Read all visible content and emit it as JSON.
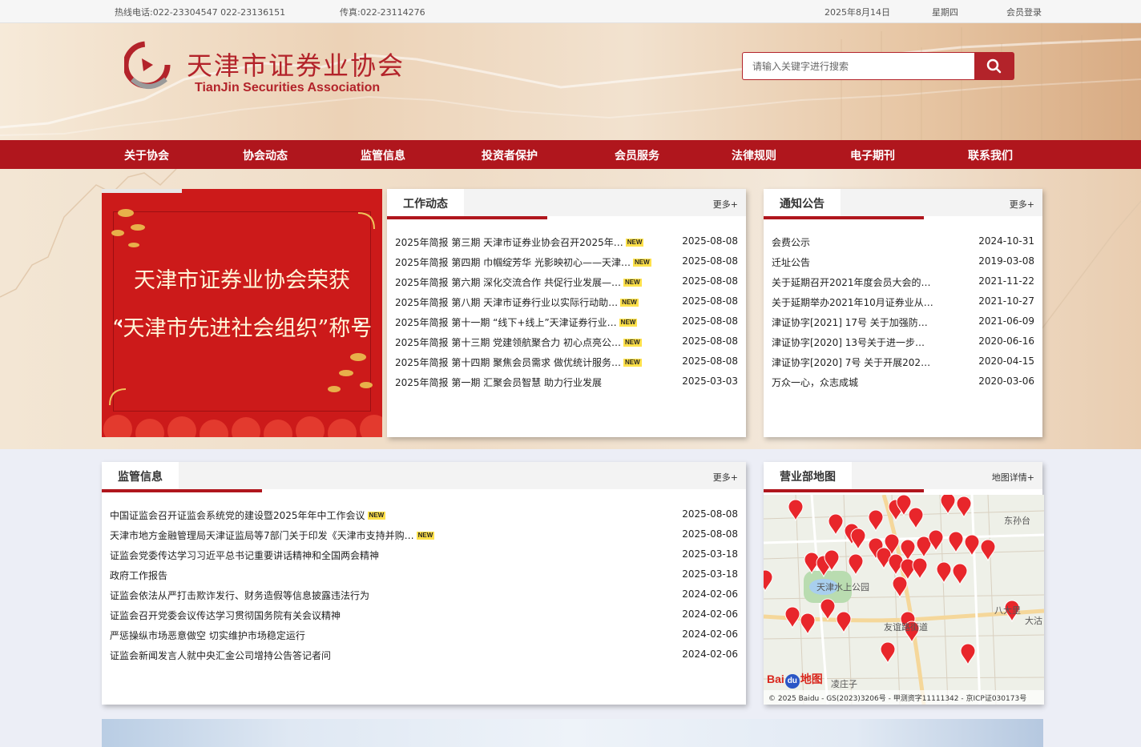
{
  "topbar": {
    "hotline": "热线电话:022-23304547  022-23136151",
    "fax": "传真:022-23114276",
    "date": "2025年8月14日",
    "weekday": "星期四",
    "login": "会员登录"
  },
  "header": {
    "logo_cn": "天津市证券业协会",
    "logo_en": "TianJin Securities Association",
    "search_placeholder": "请输入关键字进行搜索",
    "search_icon": "search-icon"
  },
  "nav": [
    "关于协会",
    "协会动态",
    "监管信息",
    "投资者保护",
    "会员服务",
    "法律规则",
    "电子期刊",
    "联系我们"
  ],
  "slider": {
    "line1": "天津市证券业协会荣获",
    "line2": "“天津市先进社会组织”称号",
    "prev": "‹",
    "next": "›"
  },
  "work": {
    "title": "工作动态",
    "more": "更多+",
    "new_label": "NEW",
    "items": [
      {
        "text": "2025年简报  第三期  天津市证券业协会召开2025年…",
        "date": "2025-08-08",
        "new": true
      },
      {
        "text": "2025年简报  第四期  巾帼绽芳华  光影映初心——天津…",
        "date": "2025-08-08",
        "new": true
      },
      {
        "text": "2025年简报  第六期  深化交流合作  共促行业发展—…",
        "date": "2025-08-08",
        "new": true
      },
      {
        "text": "2025年简报  第八期  天津市证券行业以实际行动助…",
        "date": "2025-08-08",
        "new": true
      },
      {
        "text": "2025年简报  第十一期  “线下+线上”天津证券行业…",
        "date": "2025-08-08",
        "new": true
      },
      {
        "text": "2025年简报  第十三期  党建领航聚合力  初心点亮公…",
        "date": "2025-08-08",
        "new": true
      },
      {
        "text": "2025年简报  第十四期  聚焦会员需求  做优统计服务…",
        "date": "2025-08-08",
        "new": true
      },
      {
        "text": "2025年简报  第一期  汇聚会员智慧  助力行业发展",
        "date": "2025-03-03",
        "new": false
      }
    ]
  },
  "notice": {
    "title": "通知公告",
    "more": "更多+",
    "items": [
      {
        "text": "会费公示",
        "date": "2024-10-31"
      },
      {
        "text": "迁址公告",
        "date": "2019-03-08"
      },
      {
        "text": "关于延期召开2021年度会员大会的…",
        "date": "2021-11-22"
      },
      {
        "text": "关于延期举办2021年10月证券业从…",
        "date": "2021-10-27"
      },
      {
        "text": "津证协字[2021] 17号 关于加强防…",
        "date": "2021-06-09"
      },
      {
        "text": "津证协字[2020] 13号关于进一步…",
        "date": "2020-06-16"
      },
      {
        "text": "津证协字[2020] 7号 关于开展202…",
        "date": "2020-04-15"
      },
      {
        "text": "万众一心，众志成城",
        "date": "2020-03-06"
      }
    ]
  },
  "regulation": {
    "title": "监管信息",
    "more": "更多+",
    "new_label": "NEW",
    "items": [
      {
        "text": "中国证监会召开证监会系统党的建设暨2025年年中工作会议",
        "date": "2025-08-08",
        "new": true
      },
      {
        "text": "天津市地方金融管理局天津证监局等7部门关于印发《天津市支持并购…",
        "date": "2025-08-08",
        "new": true
      },
      {
        "text": "证监会党委传达学习习近平总书记重要讲话精神和全国两会精神",
        "date": "2025-03-18",
        "new": false
      },
      {
        "text": "政府工作报告",
        "date": "2025-03-18",
        "new": false
      },
      {
        "text": "证监会依法从严打击欺诈发行、财务造假等信息披露违法行为",
        "date": "2024-02-06",
        "new": false
      },
      {
        "text": "证监会召开党委会议传达学习贯彻国务院有关会议精神",
        "date": "2024-02-06",
        "new": false
      },
      {
        "text": "严惩操纵市场恶意做空  切实维护市场稳定运行",
        "date": "2024-02-06",
        "new": false
      },
      {
        "text": "证监会新闻发言人就中央汇金公司增持公告答记者问",
        "date": "2024-02-06",
        "new": false
      }
    ]
  },
  "map": {
    "title": "营业部地图",
    "more": "地图详情+",
    "labels": [
      "东孙台",
      "天津水上公园",
      "友谊路街道",
      "八大里",
      "大沽",
      "凌庄子"
    ],
    "brand": "Bai",
    "brand_paw": "du",
    "brand_suffix": "地图",
    "attribution": "© 2025 Baidu - GS(2023)3206号 - 甲测资字11111342 - 京ICP证030173号",
    "pin_color": "#e8262b"
  },
  "colors": {
    "brand": "#b0161d",
    "logo": "#b3232a"
  }
}
